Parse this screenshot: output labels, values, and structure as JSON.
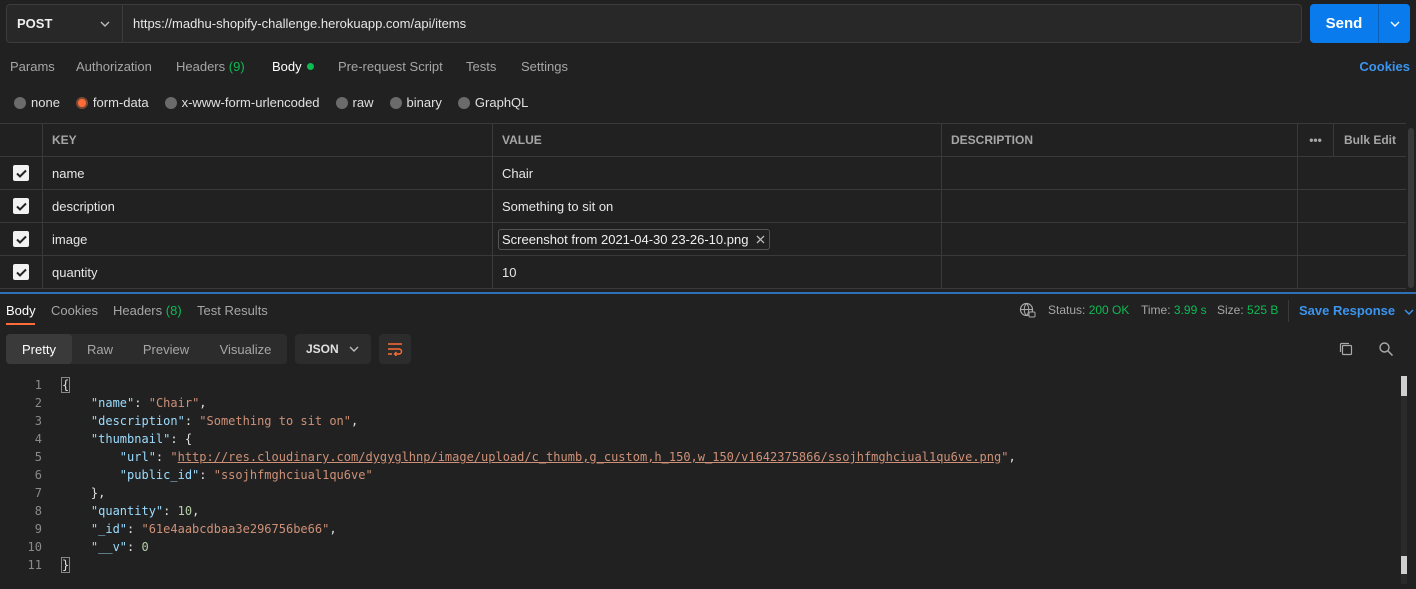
{
  "request": {
    "method": "POST",
    "url": "https://madhu-shopify-challenge.herokuapp.com/api/items",
    "send_label": "Send"
  },
  "request_tabs": {
    "params": "Params",
    "authorization": "Authorization",
    "headers": "Headers",
    "headers_count": "(9)",
    "body": "Body",
    "pre_request": "Pre-request Script",
    "tests": "Tests",
    "settings": "Settings",
    "cookies": "Cookies"
  },
  "body_types": [
    "none",
    "form-data",
    "x-www-form-urlencoded",
    "raw",
    "binary",
    "GraphQL"
  ],
  "body_type_selected": "form-data",
  "form_table": {
    "headers": {
      "key": "KEY",
      "value": "VALUE",
      "description": "DESCRIPTION",
      "more": "•••",
      "bulk_edit": "Bulk Edit"
    },
    "rows": [
      {
        "key": "name",
        "value": "Chair",
        "checked": true
      },
      {
        "key": "description",
        "value": "Something to sit on",
        "checked": true
      },
      {
        "key": "image",
        "value": "Screenshot from 2021-04-30 23-26-10.png",
        "checked": true,
        "is_file": true
      },
      {
        "key": "quantity",
        "value": "10",
        "checked": true
      }
    ]
  },
  "response_tabs": {
    "body": "Body",
    "cookies": "Cookies",
    "headers": "Headers",
    "headers_count": "(8)",
    "test_results": "Test Results"
  },
  "response_status": {
    "status_label": "Status:",
    "status_value": "200 OK",
    "time_label": "Time:",
    "time_value": "3.99 s",
    "size_label": "Size:",
    "size_value": "525 B",
    "save_response": "Save Response"
  },
  "view_modes": [
    "Pretty",
    "Raw",
    "Preview",
    "Visualize"
  ],
  "view_mode_selected": "Pretty",
  "format": "JSON",
  "code_lines": [
    "1",
    "2",
    "3",
    "4",
    "5",
    "6",
    "7",
    "8",
    "9",
    "10",
    "11"
  ],
  "response_json": {
    "open": "{",
    "name_key": "\"name\"",
    "name_val": "\"Chair\"",
    "description_key": "\"description\"",
    "description_val": "\"Something to sit on\"",
    "thumbnail_key": "\"thumbnail\"",
    "url_key": "\"url\"",
    "url_val_q": "\"",
    "url_val": "http://res.cloudinary.com/dygyglhnp/image/upload/c_thumb,g_custom,h_150,w_150/v1642375866/ssojhfmghciual1qu6ve.png",
    "public_id_key": "\"public_id\"",
    "public_id_val": "\"ssojhfmghciual1qu6ve\"",
    "thumb_close": "},",
    "quantity_key": "\"quantity\"",
    "quantity_val": "10",
    "id_key": "\"_id\"",
    "id_val": "\"61e4aabcdbaa3e296756be66\"",
    "v_key": "\"__v\"",
    "v_val": "0",
    "close": "}"
  }
}
